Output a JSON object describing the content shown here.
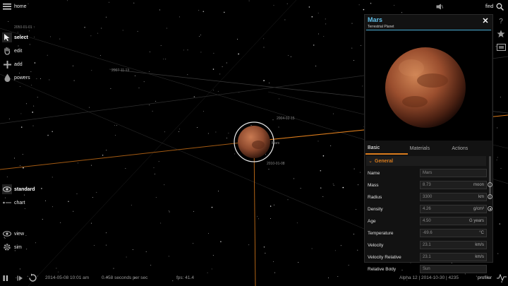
{
  "menu": {
    "home": "home",
    "select": "select",
    "edit": "edit",
    "add": "add",
    "powers": "powers",
    "standard": "standard",
    "chart": "chart",
    "view": "view",
    "sim": "sim"
  },
  "top": {
    "find": "find"
  },
  "scene": {
    "labels": {
      "date_top": "2010-01-01 ↑",
      "date_left": "2007-11-13",
      "date_mid": "2004-02-15",
      "mars_tag": "Mars",
      "date_low": "2010-01-08"
    },
    "icons": {
      "pause": "pause-icon",
      "step": "step-forward-icon",
      "rewind": "rewind-icon"
    }
  },
  "panel": {
    "title": "Mars",
    "subtitle": "Terrestrial Planet",
    "tabs": [
      "Basic",
      "Materials",
      "Actions"
    ],
    "section": "General",
    "properties": [
      {
        "label": "Name",
        "value": "Mars",
        "unit": ""
      },
      {
        "label": "Mass",
        "value": "8.73",
        "unit": "moon"
      },
      {
        "label": "Radius",
        "value": "3300",
        "unit": "km"
      },
      {
        "label": "Density",
        "value": "4.26",
        "unit": "g/cm³"
      },
      {
        "label": "Age",
        "value": "4.50",
        "unit": "G years"
      },
      {
        "label": "Temperature",
        "value": "-69.6",
        "unit": "°C"
      },
      {
        "label": "Velocity",
        "value": "23.1",
        "unit": "km/s"
      },
      {
        "label": "Velocity Relative",
        "value": "23.1",
        "unit": "km/s"
      },
      {
        "label": "Relative Body",
        "value": "Sun",
        "unit": ""
      }
    ]
  },
  "bottom": {
    "datetime": "2014-05-08 10:01 am",
    "rate": "0.458 seconds per sec",
    "fps": "fps: 41.4",
    "version": "Alpha 12  |  2014-10-30  |  4235",
    "profiler": "profiler"
  },
  "colors": {
    "accent": "#d97b1c",
    "title": "#61c0ea"
  }
}
